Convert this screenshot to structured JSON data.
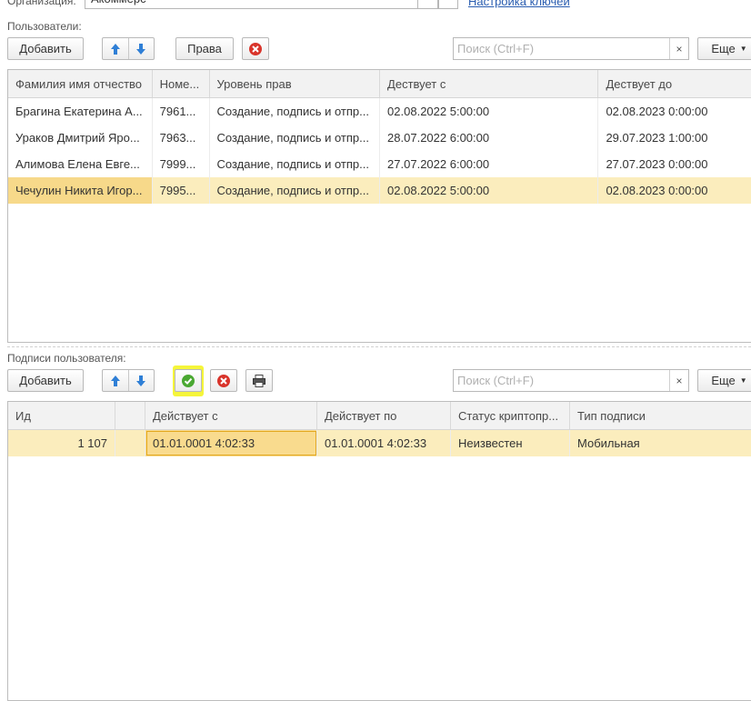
{
  "organization": {
    "label": "Организация:",
    "value": "Акоммерс",
    "link": "Настройка ключей"
  },
  "users_section": {
    "label": "Пользователи:",
    "toolbar": {
      "add_label": "Добавить",
      "rights_label": "Права",
      "search_placeholder": "Поиск (Ctrl+F)",
      "clear_glyph": "×",
      "more_label": "Еще"
    },
    "columns": [
      "Фамилия имя отчество",
      "Номе...",
      "Уровень прав",
      "Дествует с",
      "Дествует до"
    ],
    "rows": [
      {
        "name": "Брагина Екатерина А...",
        "number": "7961...",
        "level": "Создание, подпись и отпр...",
        "from": "02.08.2022 5:00:00",
        "to": "02.08.2023 0:00:00"
      },
      {
        "name": "Ураков Дмитрий Яро...",
        "number": "7963...",
        "level": "Создание, подпись и отпр...",
        "from": "28.07.2022 6:00:00",
        "to": "29.07.2023 1:00:00"
      },
      {
        "name": "Алимова Елена Евге...",
        "number": "7999...",
        "level": "Создание, подпись и отпр...",
        "from": "27.07.2022 6:00:00",
        "to": "27.07.2023 0:00:00"
      },
      {
        "name": "Чечулин Никита Игор...",
        "number": "7995...",
        "level": "Создание, подпись и отпр...",
        "from": "02.08.2022 5:00:00",
        "to": "02.08.2023 0:00:00"
      }
    ]
  },
  "signatures_section": {
    "label": "Подписи пользователя:",
    "toolbar": {
      "add_label": "Добавить",
      "search_placeholder": "Поиск (Ctrl+F)",
      "clear_glyph": "×",
      "more_label": "Еще"
    },
    "columns": [
      "Ид",
      "",
      "Действует с",
      "Действует по",
      "Статус криптопр...",
      "Тип подписи"
    ],
    "rows": [
      {
        "id": "1 107",
        "flag": "",
        "from": "01.01.0001 4:02:33",
        "to": "01.01.0001 4:02:33",
        "status": "Неизвестен",
        "type": "Мобильная"
      }
    ]
  },
  "colors": {
    "selected_row": "#fbedbd",
    "focus_cell": "#f9db8e",
    "highlight": "#f5f53a",
    "arrow_blue": "#2f7fd6",
    "delete_red": "#d9342b",
    "check_green": "#4aa832"
  }
}
